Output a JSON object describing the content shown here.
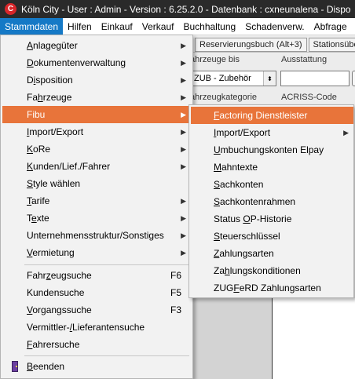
{
  "window": {
    "title": "Köln City - User : Admin - Version : 6.25.2.0 - Datenbank : cxneunalena - Dispo"
  },
  "menubar": {
    "items": [
      "Stammdaten",
      "Hilfen",
      "Einkauf",
      "Verkauf",
      "Buchhaltung",
      "Schadenverw.",
      "Abfrage"
    ]
  },
  "background": {
    "tabs": [
      "Reservierungsbuch (Alt+3)",
      "Stationsübers"
    ],
    "labels": {
      "fahrzeuge_bis": "ahrzeuge bis",
      "ausstattung": "Ausstattung",
      "fahrzeugkategorie": "ahrzeugkategorie",
      "acriss": "ACRISS-Code"
    },
    "select_value": "ZUB - Zubehör"
  },
  "menu_stammdaten": {
    "items": [
      {
        "label": "Anlagegüter",
        "u": 0,
        "submenu": true
      },
      {
        "label": "Dokumentenverwaltung",
        "u": 0,
        "submenu": true
      },
      {
        "label": "Disposition",
        "u": 1,
        "submenu": true
      },
      {
        "label": "Fahrzeuge",
        "u": 2,
        "submenu": true
      },
      {
        "label": "Fibu",
        "u": -1,
        "submenu": true
      },
      {
        "label": "Import/Export",
        "u": 0,
        "submenu": true
      },
      {
        "label": "KoRe",
        "u": 0,
        "submenu": true
      },
      {
        "label": "Kunden/Lief./Fahrer",
        "u": 0,
        "submenu": true
      },
      {
        "label": "Style wählen",
        "u": 0,
        "submenu": false
      },
      {
        "label": "Tarife",
        "u": 0,
        "submenu": true
      },
      {
        "label": "Texte",
        "u": 1,
        "submenu": true
      },
      {
        "label": "Unternehmensstruktur/Sonstiges",
        "u": -1,
        "submenu": true
      },
      {
        "label": "Vermietung",
        "u": 0,
        "submenu": true
      },
      {
        "label": "Fahrzeugsuche",
        "u": 4,
        "shortcut": "F6"
      },
      {
        "label": "Kundensuche",
        "u": -1,
        "shortcut": "F5"
      },
      {
        "label": "Vorgangssuche",
        "u": 0,
        "shortcut": "F3"
      },
      {
        "label": "Vermittler-/Lieferantensuche",
        "u": 11,
        "shortcut": ""
      },
      {
        "label": "Fahrersuche",
        "u": 0,
        "shortcut": ""
      },
      {
        "label": "Beenden",
        "u": 0,
        "shortcut": ""
      }
    ]
  },
  "menu_fibu": {
    "items": [
      {
        "label": "Factoring Dienstleister",
        "u": 0,
        "submenu": false
      },
      {
        "label": "Import/Export",
        "u": 0,
        "submenu": true
      },
      {
        "label": "Umbuchungskonten Elpay",
        "u": 0,
        "submenu": false
      },
      {
        "label": "Mahntexte",
        "u": 0,
        "submenu": false
      },
      {
        "label": "Sachkonten",
        "u": 0,
        "submenu": false
      },
      {
        "label": "Sachkontenrahmen",
        "u": 0,
        "submenu": false
      },
      {
        "label": "Status OP-Historie",
        "u": 7,
        "submenu": false
      },
      {
        "label": "Steuerschlüssel",
        "u": 0,
        "submenu": false
      },
      {
        "label": "Zahlungsarten",
        "u": 0,
        "submenu": false
      },
      {
        "label": "Zahlungskonditionen",
        "u": 2,
        "submenu": false
      },
      {
        "label": "ZUGFeRD Zahlungsarten",
        "u": 3,
        "submenu": false
      }
    ]
  },
  "icons": {
    "submenu_arrow": "chevron-right-icon",
    "exit": "door-exit-icon",
    "app": "app-logo-icon"
  },
  "colors": {
    "highlight": "#e8743a",
    "menubar_active": "#1579c6",
    "titlebar": "#2a2a2a"
  }
}
